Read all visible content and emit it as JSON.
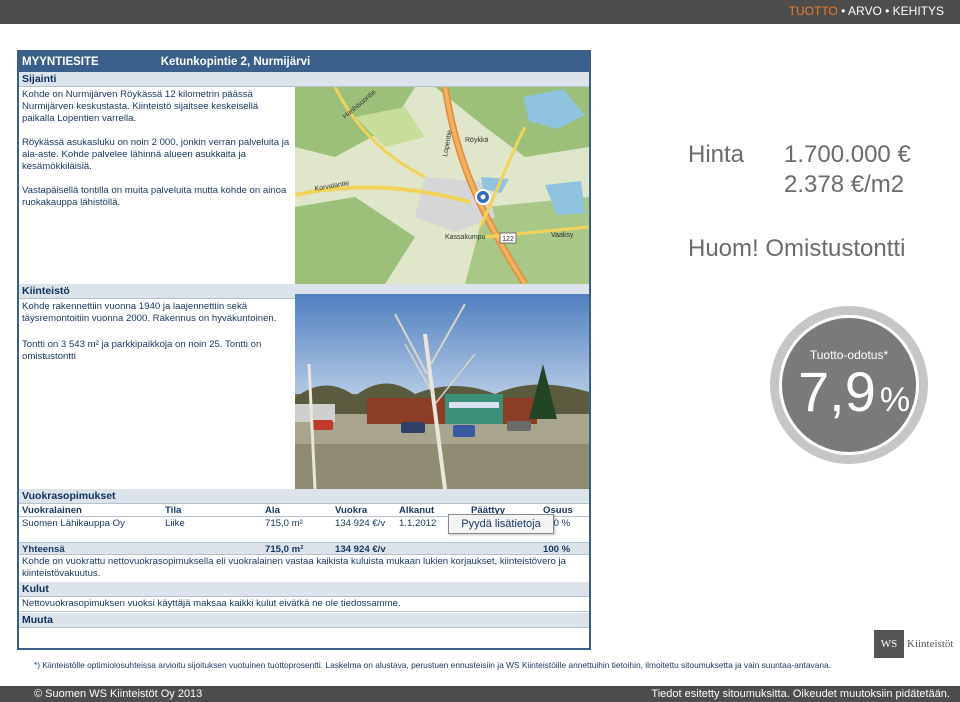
{
  "header": {
    "tagline_accent": "TUOTTO",
    "tagline_rest": " • ARVO • KEHITYS"
  },
  "sheet": {
    "title": "MYYNTIESITE",
    "address": "Ketunkopintie 2, Nurmijärvi",
    "sijainti": {
      "heading": "Sijainti",
      "p1": "Kohde on Nurmijärven Röykässä 12 kilometrin päässä Nurmijärven keskustasta. Kiinteistö sijaitsee keskeisellä paikalla Lopentien varrella.",
      "p2": "Röykässä asukasluku on noin 2 000, jonkin verran palveluita ja ala-aste. Kohde palvelee lähinnä alueen asukkaita ja kesämökkiläisiä.",
      "p3": "Vastapäisellä tontilla on muita palveluita mutta kohde on ainoa ruokakauppa lähistöllä."
    },
    "map_labels": {
      "royka": "Röykkä",
      "kassa": "Kassakumpu",
      "road": "122",
      "lopentie": "Lopentie",
      "vaaksy": "Vaaksy",
      "hanhisuo": "Hanhisuontie",
      "korvalantie": "Korvalantie"
    },
    "kiinteisto": {
      "heading": "Kiinteistö",
      "p1": "Kohde rakennettiin vuonna 1940 ja laajennettiin sekä täysremontoitiin vuonna 2000. Rakennus on hyväkuntoinen.",
      "p2": "Tontti on 3 543 m² ja parkkipaikkoja on noin 25. Tontti on omistustontti"
    },
    "vuokra": {
      "heading": "Vuokrasopimukset",
      "columns": [
        "Vuokralainen",
        "Tila",
        "Ala",
        "Vuokra",
        "Alkanut",
        "Päättyy",
        "Osuus"
      ],
      "row": [
        "Suomen Lähikauppa Oy",
        "Liike",
        "715,0 m²",
        "134 924 €/v",
        "1.1.2012",
        "",
        "100 %"
      ],
      "total": [
        "Yhteensä",
        "",
        "715,0 m²",
        "134 924 €/v",
        "",
        "",
        "100 %"
      ],
      "note": "Kohde on vuokrattu nettovuokrasopimuksella eli vuokralainen vastaa kaikista kuluista mukaan lukien korjaukset, kiinteistövero ja kiinteistövakuutus."
    },
    "kulut": {
      "heading": "Kulut",
      "text": "Nettovuokrasopimuksen vuoksi käyttäjä maksaa kaikki kulut eivätkä ne ole tiedossamme."
    },
    "muuta": {
      "heading": "Muuta"
    }
  },
  "request_button": "Pyydä lisätietoja",
  "price": {
    "label": "Hinta",
    "value": "1.700.000 €",
    "per_m2": "2.378 €/m2"
  },
  "note": "Huom! Omistustontti",
  "yield": {
    "label": "Tuotto-odotus*",
    "value": "7,9",
    "unit": "%"
  },
  "logo": {
    "mark": "WS",
    "name": "Kiinteistöt"
  },
  "footnote": {
    "line1": "*) Kiinteistölle optimiolosuhteissa arvioitu sijoituksen vuotuinen tuottoprosentti. Laskelma on alustava, perustuen ennusteisiin ja WS Kiinteistöille annettuihin tietoihin, ilmoitettu sitoumuksetta ja vain suuntaa-antavana."
  },
  "footer": {
    "copyright": "© Suomen WS Kiinteistöt Oy 2013",
    "rights": "Tiedot esitetty sitoumuksitta. Oikeudet muutoksiin pidätetään."
  },
  "colors": {
    "brand_blue": "#3a5f8a",
    "accent_orange": "#f07a2a",
    "bar_gray": "#4d4d4d",
    "circle_gray": "#7a7a7a"
  }
}
